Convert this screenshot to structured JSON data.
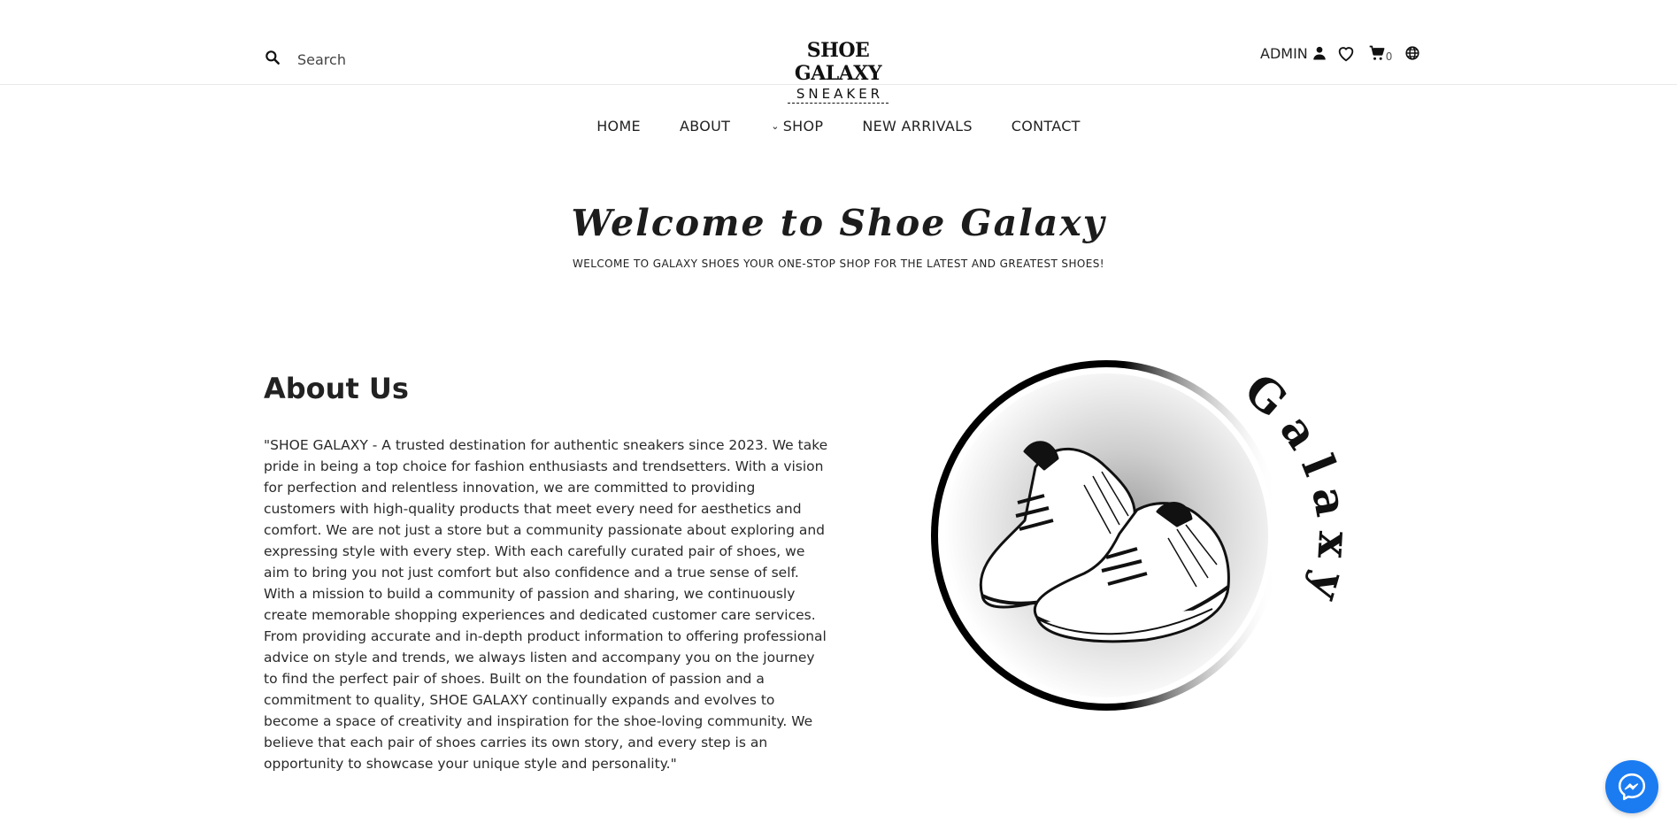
{
  "header": {
    "search": {
      "placeholder": "Search",
      "value": ""
    },
    "logo": {
      "line1": "SHOE GALAXY",
      "line2": "SNEAKER"
    },
    "admin_label": "ADMIN",
    "cart_count": "0",
    "icons": [
      "search-icon",
      "user-icon",
      "heart-icon",
      "cart-icon",
      "globe-icon"
    ]
  },
  "nav": {
    "items": [
      {
        "label": "HOME"
      },
      {
        "label": "ABOUT"
      },
      {
        "label": "SHOP",
        "has_dropdown": true
      },
      {
        "label": "NEW ARRIVALS"
      },
      {
        "label": "CONTACT"
      }
    ]
  },
  "hero": {
    "title": "Welcome to Shoe Galaxy",
    "subtitle": "WELCOME TO GALAXY SHOES YOUR ONE-STOP SHOP FOR THE LATEST AND GREATEST SHOES!"
  },
  "about": {
    "title": "About Us",
    "body": "\"SHOE GALAXY - A trusted destination for authentic sneakers since 2023. We take pride in being a top choice for fashion enthusiasts and trendsetters. With a vision for perfection and relentless innovation, we are committed to providing customers with high-quality products that meet every need for aesthetics and comfort. We are not just a store but a community passionate about exploring and expressing style with every step. With each carefully curated pair of shoes, we aim to bring you not just comfort but also confidence and a true sense of self. With a mission to build a community of passion and sharing, we continuously create memorable shopping experiences and dedicated customer care services. From providing accurate and in-depth product information to offering professional advice on style and trends, we always listen and accompany you on the journey to find the perfect pair of shoes. Built on the foundation of passion and a commitment to quality, SHOE GALAXY continually expands and evolves to become a space of creativity and inspiration for the shoe-loving community. We believe that each pair of shoes carries its own story, and every step is an opportunity to showcase your unique style and personality.\"",
    "illustration_text": "Galaxy"
  },
  "colors": {
    "messenger": "#1b7cf2",
    "text": "#222222"
  }
}
